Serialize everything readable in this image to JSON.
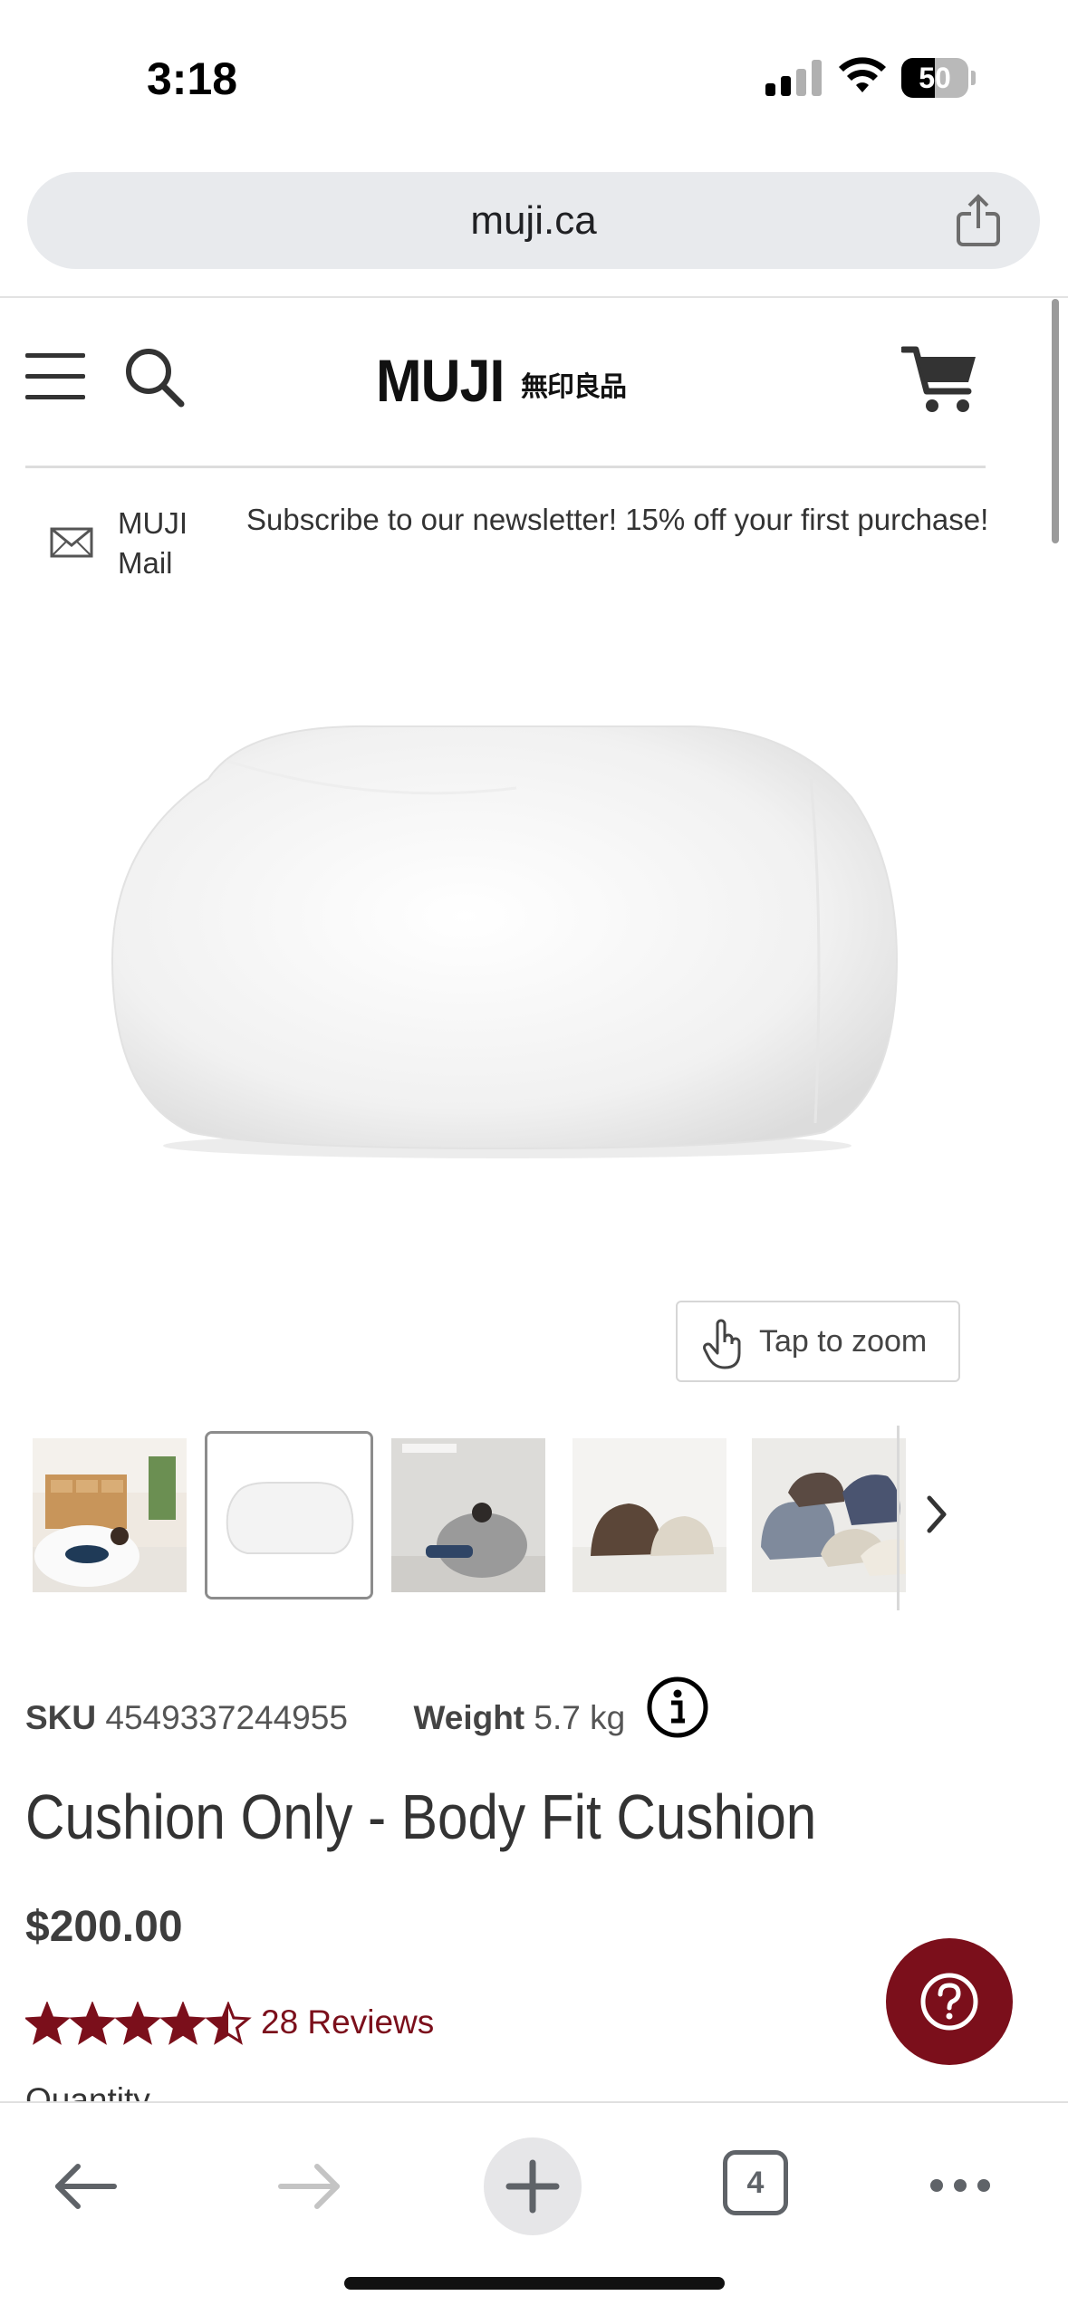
{
  "status_bar": {
    "time": "3:18",
    "battery": "50",
    "battery_level": 0.5
  },
  "browser": {
    "url": "muji.ca",
    "tab_count": "4"
  },
  "header": {
    "logo_text": "MUJI",
    "logo_jp": "無印良品"
  },
  "newsletter": {
    "mail_label": "MUJI Mail",
    "text": "Subscribe to our newsletter! 15% off your first purchase!"
  },
  "gallery": {
    "zoom_label": "Tap to zoom",
    "thumbnails": [
      "lifestyle-woman-on-cushion",
      "white-cushion",
      "person-on-grey-cushion",
      "brown-and-white-cushions",
      "assorted-color-cushions"
    ],
    "selected_index": 1
  },
  "product": {
    "sku_label": "SKU",
    "sku": "4549337244955",
    "weight_label": "Weight",
    "weight": "5.7 kg",
    "title": "Cushion Only - Body Fit Cushion",
    "price": "$200.00",
    "rating": 4.5,
    "reviews": "28 Reviews",
    "quantity_label": "Quantity"
  },
  "colors": {
    "accent": "#7b0f1b",
    "text": "#333333",
    "url_bar": "#e8eaed"
  }
}
